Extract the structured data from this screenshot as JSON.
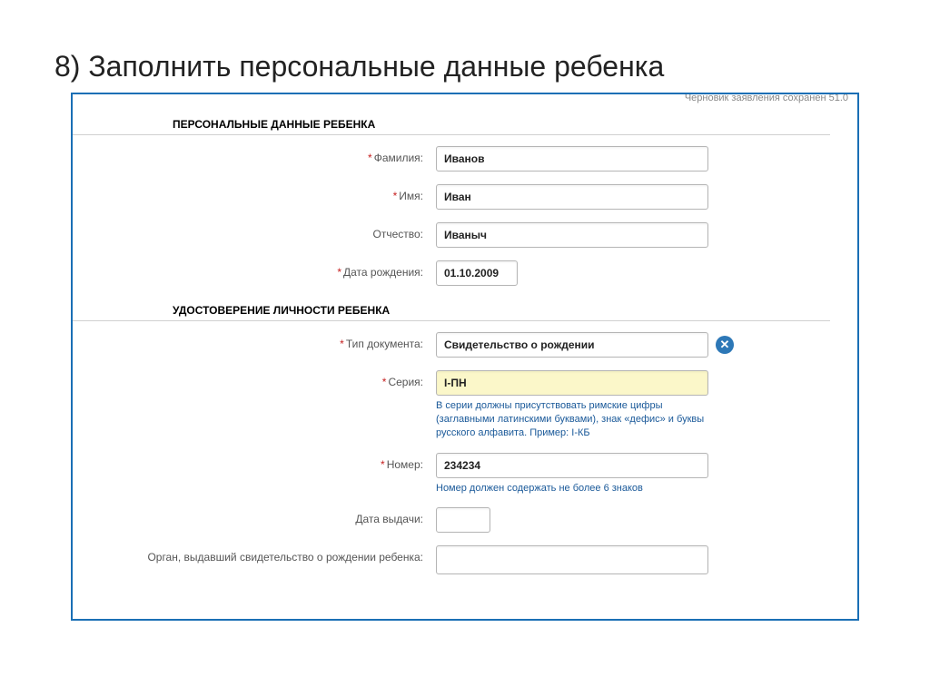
{
  "slide": {
    "title": "8) Заполнить персональные данные ребенка"
  },
  "draft_note": "Черновик заявления сохранен 51.0",
  "sections": {
    "personal": {
      "title": "ПЕРСОНАЛЬНЫЕ ДАННЫЕ РЕБЕНКА",
      "fields": {
        "surname": {
          "label": "Фамилия:",
          "value": "Иванов"
        },
        "name": {
          "label": "Имя:",
          "value": "Иван"
        },
        "patronymic": {
          "label": "Отчество:",
          "value": "Иваныч"
        },
        "dob": {
          "label": "Дата рождения:",
          "value": "01.10.2009"
        }
      }
    },
    "identity": {
      "title": "УДОСТОВЕРЕНИЕ ЛИЧНОСТИ РЕБЕНКА",
      "fields": {
        "doc_type": {
          "label": "Тип документа:",
          "value": "Свидетельство о рождении"
        },
        "series": {
          "label": "Серия:",
          "value": "I-ПН",
          "hint": "В серии должны присутствовать римские цифры (заглавными латинскими буквами), знак «дефис» и буквы русского алфавита. Пример: I-КБ"
        },
        "number": {
          "label": "Номер:",
          "value": "234234",
          "hint": "Номер должен содержать не более 6 знаков"
        },
        "issue_date": {
          "label": "Дата выдачи:",
          "value": ""
        },
        "issuing_org": {
          "label": "Орган, выдавший свидетельство о рождении ребенка:",
          "value": ""
        }
      }
    }
  }
}
